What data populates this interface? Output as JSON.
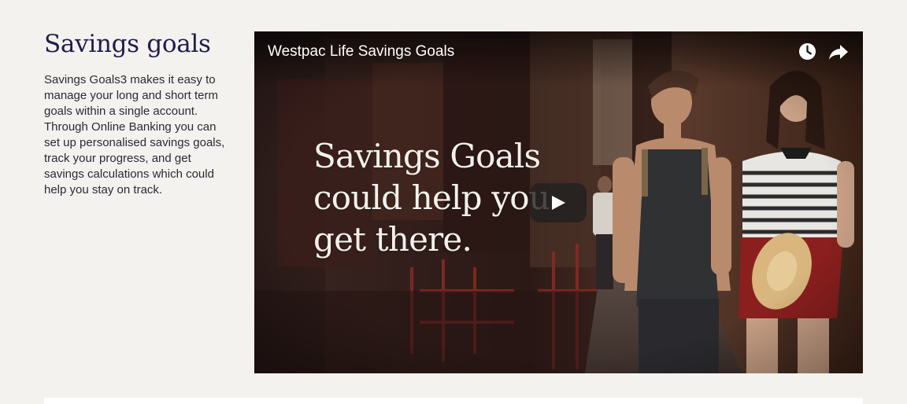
{
  "section": {
    "title": "Savings goals",
    "description": "Savings Goals3 makes it easy to manage your long and short term goals within a single account. Through Online Banking you can set up personalised savings goals, track your progress, and get savings calculations which could help you stay on track."
  },
  "video": {
    "title": "Westpac Life Savings Goals",
    "overlay_text": "Savings Goals\ncould help you\nget there.",
    "icons": [
      "clock-icon",
      "share-icon",
      "play-icon"
    ]
  },
  "colors": {
    "page_background": "#f3f2ef",
    "heading": "#1f1c4f",
    "body_text": "#2b2a33"
  }
}
